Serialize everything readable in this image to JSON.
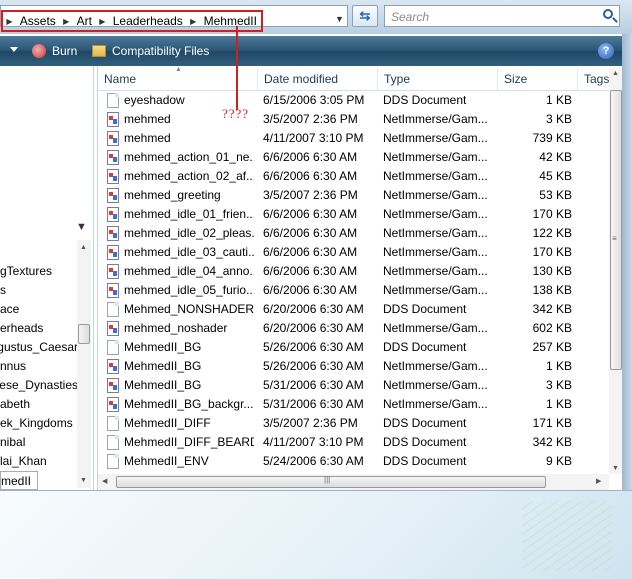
{
  "address": {
    "crumbs": [
      "Assets",
      "Art",
      "Leaderheads",
      "MehmedII"
    ]
  },
  "search": {
    "placeholder": "Search"
  },
  "annotation": {
    "text": "????"
  },
  "toolbar": {
    "burn_label": "Burn",
    "compat_label": "Compatibility Files"
  },
  "nav": {
    "items": [
      "gTextures",
      "s",
      "ace",
      "erheads",
      "gustus_Caesar",
      "nnus",
      "nese_Dynasties",
      "abeth",
      "ek_Kingdoms",
      "nibal",
      "lai_Khan",
      "medII"
    ]
  },
  "columns": {
    "name": "Name",
    "date": "Date modified",
    "type": "Type",
    "size": "Size",
    "tags": "Tags"
  },
  "files": [
    {
      "name": "eyeshadow",
      "date": "6/15/2006 3:05 PM",
      "type": "DDS Document",
      "size": "1 KB",
      "icon": "dds"
    },
    {
      "name": "mehmed",
      "date": "3/5/2007 2:36 PM",
      "type": "NetImmerse/Gam...",
      "size": "3 KB",
      "icon": "nif"
    },
    {
      "name": "mehmed",
      "date": "4/11/2007 3:10 PM",
      "type": "NetImmerse/Gam...",
      "size": "739 KB",
      "icon": "nif"
    },
    {
      "name": "mehmed_action_01_ne...",
      "date": "6/6/2006 6:30 AM",
      "type": "NetImmerse/Gam...",
      "size": "42 KB",
      "icon": "nif"
    },
    {
      "name": "mehmed_action_02_af...",
      "date": "6/6/2006 6:30 AM",
      "type": "NetImmerse/Gam...",
      "size": "45 KB",
      "icon": "nif"
    },
    {
      "name": "mehmed_greeting",
      "date": "3/5/2007 2:36 PM",
      "type": "NetImmerse/Gam...",
      "size": "53 KB",
      "icon": "nif"
    },
    {
      "name": "mehmed_idle_01_frien...",
      "date": "6/6/2006 6:30 AM",
      "type": "NetImmerse/Gam...",
      "size": "170 KB",
      "icon": "nif"
    },
    {
      "name": "mehmed_idle_02_pleas...",
      "date": "6/6/2006 6:30 AM",
      "type": "NetImmerse/Gam...",
      "size": "122 KB",
      "icon": "nif"
    },
    {
      "name": "mehmed_idle_03_cauti...",
      "date": "6/6/2006 6:30 AM",
      "type": "NetImmerse/Gam...",
      "size": "170 KB",
      "icon": "nif"
    },
    {
      "name": "mehmed_idle_04_anno...",
      "date": "6/6/2006 6:30 AM",
      "type": "NetImmerse/Gam...",
      "size": "130 KB",
      "icon": "nif"
    },
    {
      "name": "mehmed_idle_05_furio...",
      "date": "6/6/2006 6:30 AM",
      "type": "NetImmerse/Gam...",
      "size": "138 KB",
      "icon": "nif"
    },
    {
      "name": "Mehmed_NONSHADER",
      "date": "6/20/2006 6:30 AM",
      "type": "DDS Document",
      "size": "342 KB",
      "icon": "dds"
    },
    {
      "name": "mehmed_noshader",
      "date": "6/20/2006 6:30 AM",
      "type": "NetImmerse/Gam...",
      "size": "602 KB",
      "icon": "nif"
    },
    {
      "name": "MehmedII_BG",
      "date": "5/26/2006 6:30 AM",
      "type": "DDS Document",
      "size": "257 KB",
      "icon": "dds"
    },
    {
      "name": "MehmedII_BG",
      "date": "5/26/2006 6:30 AM",
      "type": "NetImmerse/Gam...",
      "size": "1 KB",
      "icon": "nif"
    },
    {
      "name": "MehmedII_BG",
      "date": "5/31/2006 6:30 AM",
      "type": "NetImmerse/Gam...",
      "size": "3 KB",
      "icon": "nif"
    },
    {
      "name": "MehmedII_BG_backgr...",
      "date": "5/31/2006 6:30 AM",
      "type": "NetImmerse/Gam...",
      "size": "1 KB",
      "icon": "nif"
    },
    {
      "name": "MehmedII_DIFF",
      "date": "3/5/2007 2:36 PM",
      "type": "DDS Document",
      "size": "171 KB",
      "icon": "dds"
    },
    {
      "name": "MehmedII_DIFF_BEARD",
      "date": "4/11/2007 3:10 PM",
      "type": "DDS Document",
      "size": "342 KB",
      "icon": "dds"
    },
    {
      "name": "MehmedII_ENV",
      "date": "5/24/2006 6:30 AM",
      "type": "DDS Document",
      "size": "9 KB",
      "icon": "dds"
    }
  ],
  "colors": {
    "annotation": "#d02020",
    "toolbar": "#2b5574",
    "header_text": "#1e395b"
  }
}
